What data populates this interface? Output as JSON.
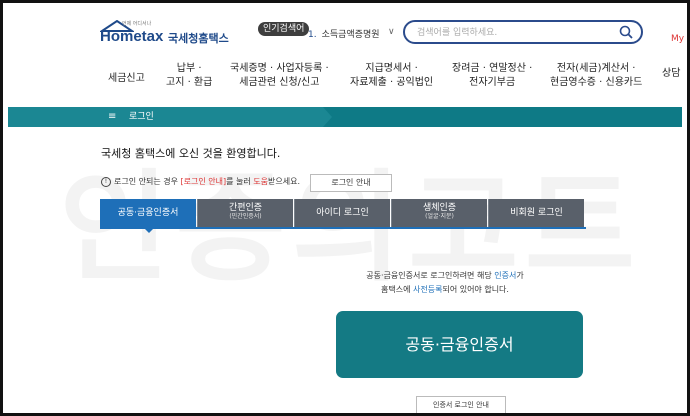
{
  "header": {
    "logo": {
      "tagline": "언제 어디서나",
      "brand_en": "Hometax",
      "brand_ko": "국세청홈택스"
    },
    "popular": {
      "badge": "인기검색어",
      "rank": "1.",
      "term": "소득금액증명원"
    },
    "search": {
      "placeholder": "검색어를 입력하세요."
    },
    "my_link": "My",
    "nav": [
      "세금신고",
      "납부 ·\n고지 · 환급",
      "국세증명 · 사업자등록 ·\n세금관련 신청/신고",
      "지급명세서 ·\n자료제출 · 공익법인",
      "장려금 · 연말정산 ·\n전자기부금",
      "전자(세금)계산서 ·\n현금영수증 · 신용카드",
      "상담"
    ]
  },
  "breadcrumb": {
    "menu_icon": "≡",
    "label": "로그인"
  },
  "watermark": "인증의코트",
  "login": {
    "welcome": "국세청 홈택스에 오신 것을 환영합니다.",
    "notice": {
      "icon": "!",
      "pre": "로그인 안되는 경우 ",
      "link": "[로그인 안내]",
      "mid": "를 눌러 ",
      "help": "도움",
      "post": "받으세요."
    },
    "help_button": "로그인 안내",
    "tabs": [
      {
        "label": "공동·금융인증서",
        "sub": ""
      },
      {
        "label": "간편인증",
        "sub": "(민간인증서)"
      },
      {
        "label": "아이디 로그인",
        "sub": ""
      },
      {
        "label": "생체인증",
        "sub": "(얼굴·지문)"
      },
      {
        "label": "비회원 로그인",
        "sub": ""
      }
    ],
    "desc": {
      "line1_pre": "공동·금융인증서로 로그인하려면 해당 ",
      "line1_hl": "인증서",
      "line1_post": "가",
      "line2_pre": "홈택스에 ",
      "line2_hl": "사전등록",
      "line2_post": "되어 있어야 합니다."
    },
    "cert_button": "공동·금융인증서",
    "guide_button": "인증서 로그인 안내"
  },
  "colors": {
    "teal": "#147a84",
    "navy": "#1f4a8a",
    "tab_active": "#1e6fb8",
    "tab": "#59606a",
    "highlight": "#d33333"
  }
}
